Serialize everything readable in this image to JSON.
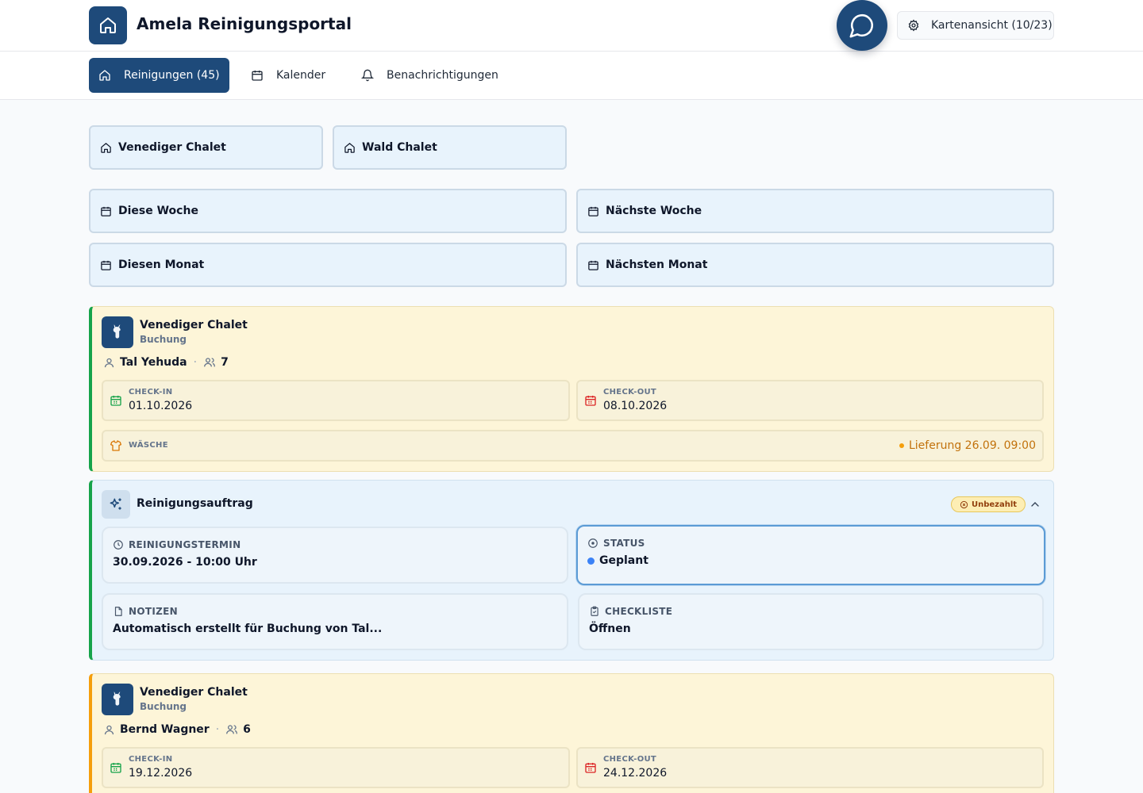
{
  "header": {
    "title": "Amela Reinigungsportal",
    "map_button": "Kartenansicht (10/23)"
  },
  "nav": {
    "items": [
      {
        "label": "Reinigungen (45)",
        "icon": "home-icon",
        "active": true
      },
      {
        "label": "Kalender",
        "icon": "calendar-icon",
        "active": false
      },
      {
        "label": "Benachrichtigungen",
        "icon": "bell-icon",
        "active": false
      }
    ]
  },
  "filters": {
    "properties": [
      "Venediger Chalet",
      "Wald Chalet"
    ],
    "periods": [
      "Diese Woche",
      "Nächste Woche",
      "Diesen Monat",
      "Nächsten Monat"
    ]
  },
  "bookings": [
    {
      "property": "Venediger Chalet",
      "type": "Buchung",
      "guest": "Tal Yehuda",
      "guests_count": "7",
      "checkin_label": "CHECK-IN",
      "checkin": "01.10.2026",
      "checkout_label": "CHECK-OUT",
      "checkout": "08.10.2026",
      "laundry_label": "WÄSCHE",
      "delivery": "Lieferung 26.09. 09:00"
    },
    {
      "property": "Venediger Chalet",
      "type": "Buchung",
      "guest": "Bernd Wagner",
      "guests_count": "6",
      "checkin_label": "CHECK-IN",
      "checkin": "19.12.2026",
      "checkout_label": "CHECK-OUT",
      "checkout": "24.12.2026"
    }
  ],
  "cleaning": {
    "title": "Reinigungsauftrag",
    "badge": "Unbezahlt",
    "date_label": "REINIGUNGSTERMIN",
    "date_value": "30.09.2026 - 10:00 Uhr",
    "status_label": "STATUS",
    "status_value": "Geplant",
    "notes_label": "NOTIZEN",
    "notes_value": "Automatisch erstellt für Buchung von Tal...",
    "checklist_label": "CHECKLISTE",
    "checklist_value": "Öffnen"
  },
  "colors": {
    "primary": "#1e4a7a",
    "accent_green": "#16a34a",
    "accent_orange": "#f59e0b",
    "status_blue": "#3b82f6"
  }
}
